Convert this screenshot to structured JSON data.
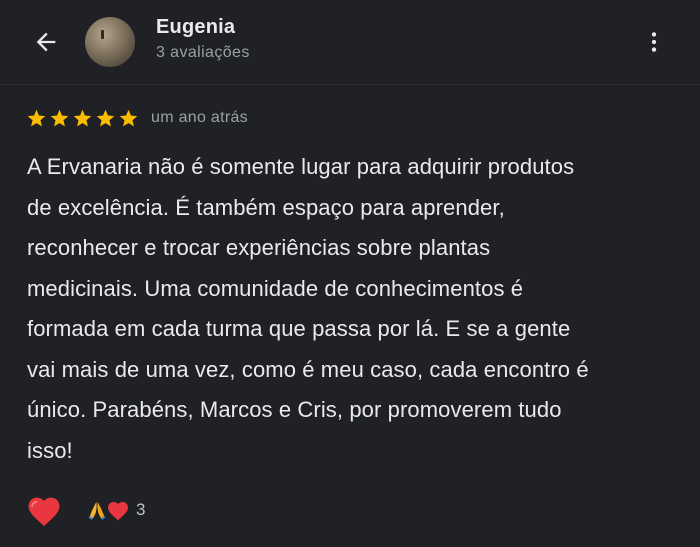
{
  "reviewer": {
    "name": "Eugenia",
    "review_count": "3 avaliações"
  },
  "review": {
    "rating": 5,
    "max_rating": 5,
    "time_ago": "um ano atrás",
    "text": "A Ervanaria não é somente lugar para adquirir produtos\nde excelência. É também espaço para aprender,\nreconhecer e trocar experiências sobre plantas\nmedicinais. Uma comunidade de conhecimentos é\nformada em cada turma que passa por lá. E se a gente\nvai mais de uma vez, como é meu caso, cada encontro é\núnico. Parabéns, Marcos e Cris, por promoverem tudo\nisso!"
  },
  "reactions": {
    "count": "3",
    "icons": [
      "folded-hands-icon",
      "heart-icon"
    ]
  },
  "icons": {
    "back": "arrow-back-icon",
    "more": "more-vert-icon",
    "react": "heart-icon"
  },
  "colors": {
    "background": "#202124",
    "star": "#fbbc04",
    "heart": "#e8373f",
    "text_primary": "#e8eaed",
    "text_secondary": "#9aa0a6"
  }
}
